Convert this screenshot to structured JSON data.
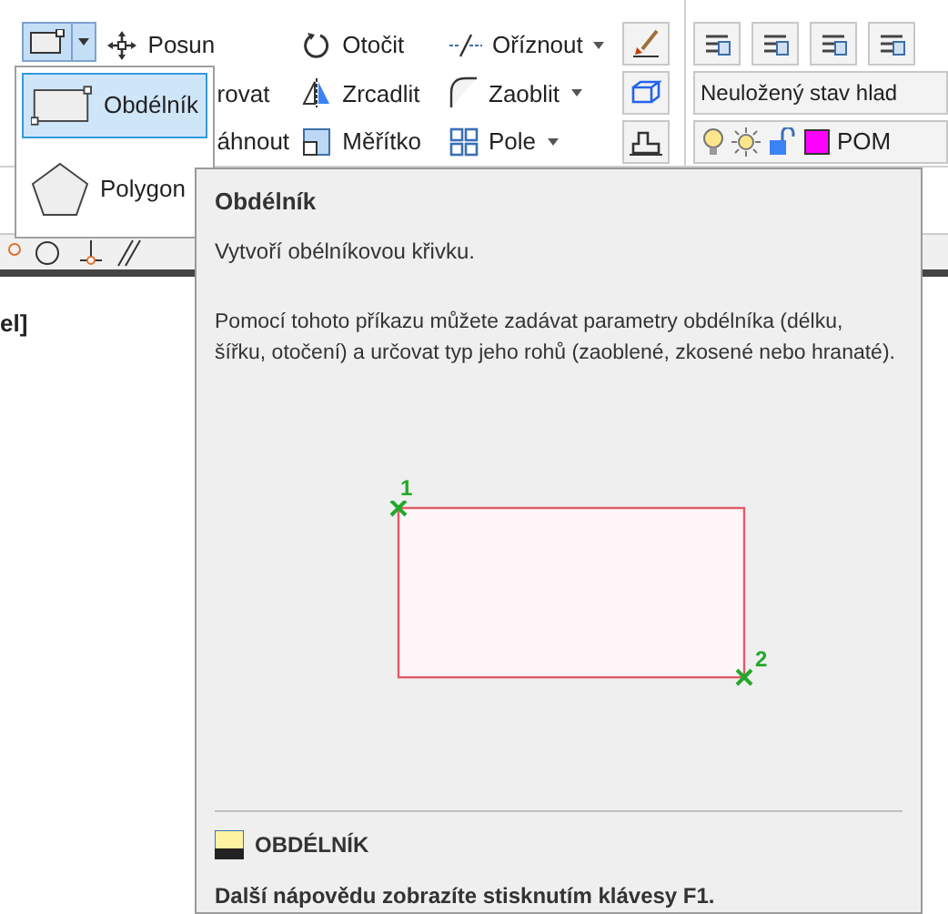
{
  "ribbon": {
    "split_button": {
      "selected": true
    },
    "columns": [
      [
        {
          "label": "Posun",
          "kind": "move"
        },
        {
          "label": "rovat",
          "kind": "text"
        },
        {
          "label": "áhnout",
          "kind": "text"
        }
      ],
      [
        {
          "label": "Otočit",
          "kind": "rotate"
        },
        {
          "label": "Zrcadlit",
          "kind": "mirror"
        },
        {
          "label": "Měřítko",
          "kind": "scale"
        }
      ],
      [
        {
          "label": "Oříznout",
          "kind": "trim",
          "menu": true
        },
        {
          "label": "Zaoblit",
          "kind": "fillet",
          "menu": true
        },
        {
          "label": "Pole",
          "kind": "array",
          "menu": true
        }
      ]
    ],
    "layers": {
      "state_field": "Neuložený stav hlad",
      "layer_name": "POM"
    }
  },
  "drawing_label": "el]",
  "flyout": {
    "items": [
      {
        "label": "Obdélník",
        "kind": "rectangle",
        "selected": true
      },
      {
        "label": "Polygon",
        "kind": "polygon",
        "selected": false
      }
    ]
  },
  "tooltip": {
    "title": "Obdélník",
    "description": "Vytvoří obélníkovou křivku.",
    "details": "Pomocí tohoto příkazu můžete zadávat parametry obdélníka (délku, šířku, otočení) a určovat typ jeho rohů (zaoblené, zkosené nebo hranaté).",
    "point_labels": [
      "1",
      "2"
    ],
    "command": "OBDÉLNÍK",
    "help": "Další nápovědu zobrazíte stisknutím klávesy F1."
  }
}
